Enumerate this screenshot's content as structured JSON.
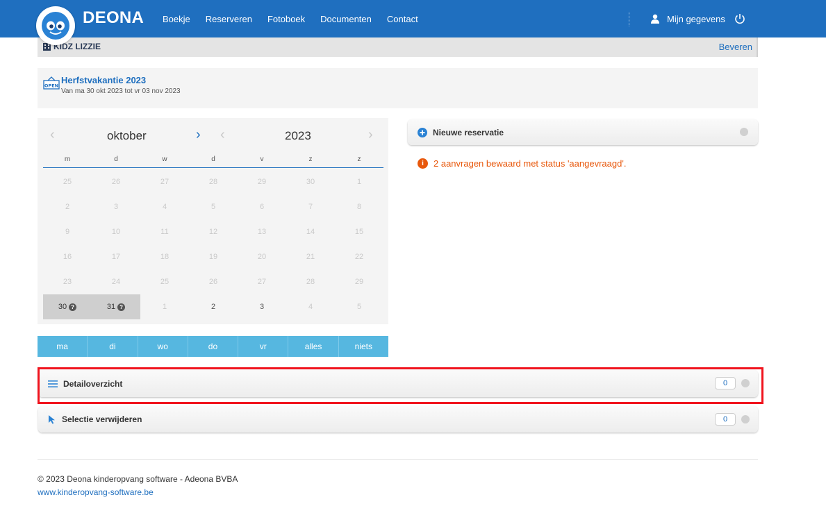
{
  "header": {
    "brand": "DEONA",
    "nav": [
      "Boekje",
      "Reserveren",
      "Fotoboek",
      "Documenten",
      "Contact"
    ],
    "user_label": "Mijn gegevens",
    "color": "#1f6fbf"
  },
  "org": {
    "name": "KIDZ LIZZIE",
    "right_link": "Beveren"
  },
  "period": {
    "badge": "OPEN",
    "title": "Herfstvakantie 2023",
    "dates": "Van ma 30 okt 2023 tot vr 03 nov 2023"
  },
  "calendar": {
    "month": "oktober",
    "year": "2023",
    "weekdays": [
      "m",
      "d",
      "w",
      "d",
      "v",
      "z",
      "z"
    ],
    "rows": [
      [
        {
          "d": "25"
        },
        {
          "d": "26"
        },
        {
          "d": "27"
        },
        {
          "d": "28"
        },
        {
          "d": "29"
        },
        {
          "d": "30"
        },
        {
          "d": "1"
        }
      ],
      [
        {
          "d": "2"
        },
        {
          "d": "3"
        },
        {
          "d": "4"
        },
        {
          "d": "5"
        },
        {
          "d": "6"
        },
        {
          "d": "7"
        },
        {
          "d": "8"
        }
      ],
      [
        {
          "d": "9"
        },
        {
          "d": "10"
        },
        {
          "d": "11"
        },
        {
          "d": "12"
        },
        {
          "d": "13"
        },
        {
          "d": "14"
        },
        {
          "d": "15"
        }
      ],
      [
        {
          "d": "16"
        },
        {
          "d": "17"
        },
        {
          "d": "18"
        },
        {
          "d": "19"
        },
        {
          "d": "20"
        },
        {
          "d": "21"
        },
        {
          "d": "22"
        }
      ],
      [
        {
          "d": "23"
        },
        {
          "d": "24"
        },
        {
          "d": "25"
        },
        {
          "d": "26"
        },
        {
          "d": "27"
        },
        {
          "d": "28"
        },
        {
          "d": "29"
        }
      ],
      [
        {
          "d": "30",
          "state": "selected",
          "info": true
        },
        {
          "d": "31",
          "state": "selected",
          "info": true
        },
        {
          "d": "1"
        },
        {
          "d": "2",
          "state": "current"
        },
        {
          "d": "3",
          "state": "current"
        },
        {
          "d": "4"
        },
        {
          "d": "5"
        }
      ]
    ]
  },
  "day_buttons": [
    "ma",
    "di",
    "wo",
    "do",
    "vr",
    "alles",
    "niets"
  ],
  "reservation": {
    "title": "Nieuwe reservatie",
    "warning": "2 aanvragen bewaard met status 'aangevraagd'."
  },
  "detail": {
    "title": "Detailoverzicht",
    "count": "0"
  },
  "selection": {
    "title": "Selectie verwijderen",
    "count": "0"
  },
  "footer": {
    "copyright": "© 2023 Deona kinderopvang software - Adeona BVBA",
    "link": "www.kinderopvang-software.be"
  }
}
